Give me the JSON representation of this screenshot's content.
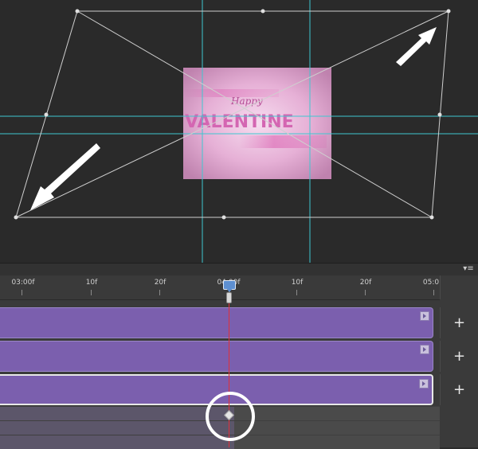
{
  "canvas": {
    "image_text_small": "Happy",
    "image_text_large": "VALENTINE",
    "colors": {
      "background": "#2a2a2a",
      "guide": "#3fc7d0",
      "transform": "#d8d8d8"
    }
  },
  "timeline": {
    "panel_menu_icon": "panel-menu-icon",
    "ruler_labels": [
      "03:00f",
      "10f",
      "20f",
      "04:00f",
      "10f",
      "20f",
      "05:0"
    ],
    "tracks": [
      {
        "id": "track-1",
        "color": "#7b5fae"
      },
      {
        "id": "track-2",
        "color": "#7b5fae"
      },
      {
        "id": "track-3",
        "color": "#7b5fae",
        "selected": true
      }
    ],
    "add_label": "+",
    "keyframe": "diamond-keyframe-icon",
    "playhead_color": "#e0303a"
  }
}
